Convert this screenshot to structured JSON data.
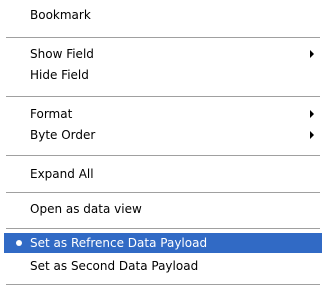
{
  "menu": {
    "items": [
      {
        "label": "Bookmark"
      },
      {
        "label": "Show Field",
        "submenu": true
      },
      {
        "label": "Hide Field"
      },
      {
        "label": "Format",
        "submenu": true
      },
      {
        "label": "Byte Order",
        "submenu": true
      },
      {
        "label": "Expand All"
      },
      {
        "label": "Open as data view"
      },
      {
        "label": "Set as Refrence Data Payload",
        "selected": true,
        "highlighted": true
      },
      {
        "label": "Set as Second Data Payload"
      }
    ]
  },
  "colors": {
    "highlight": "#316ac5",
    "highlight_text": "#ffffff",
    "separator": "#a0a0a0"
  },
  "icons": {
    "submenu": "submenu-arrow-icon",
    "selected": "radio-bullet-icon"
  }
}
